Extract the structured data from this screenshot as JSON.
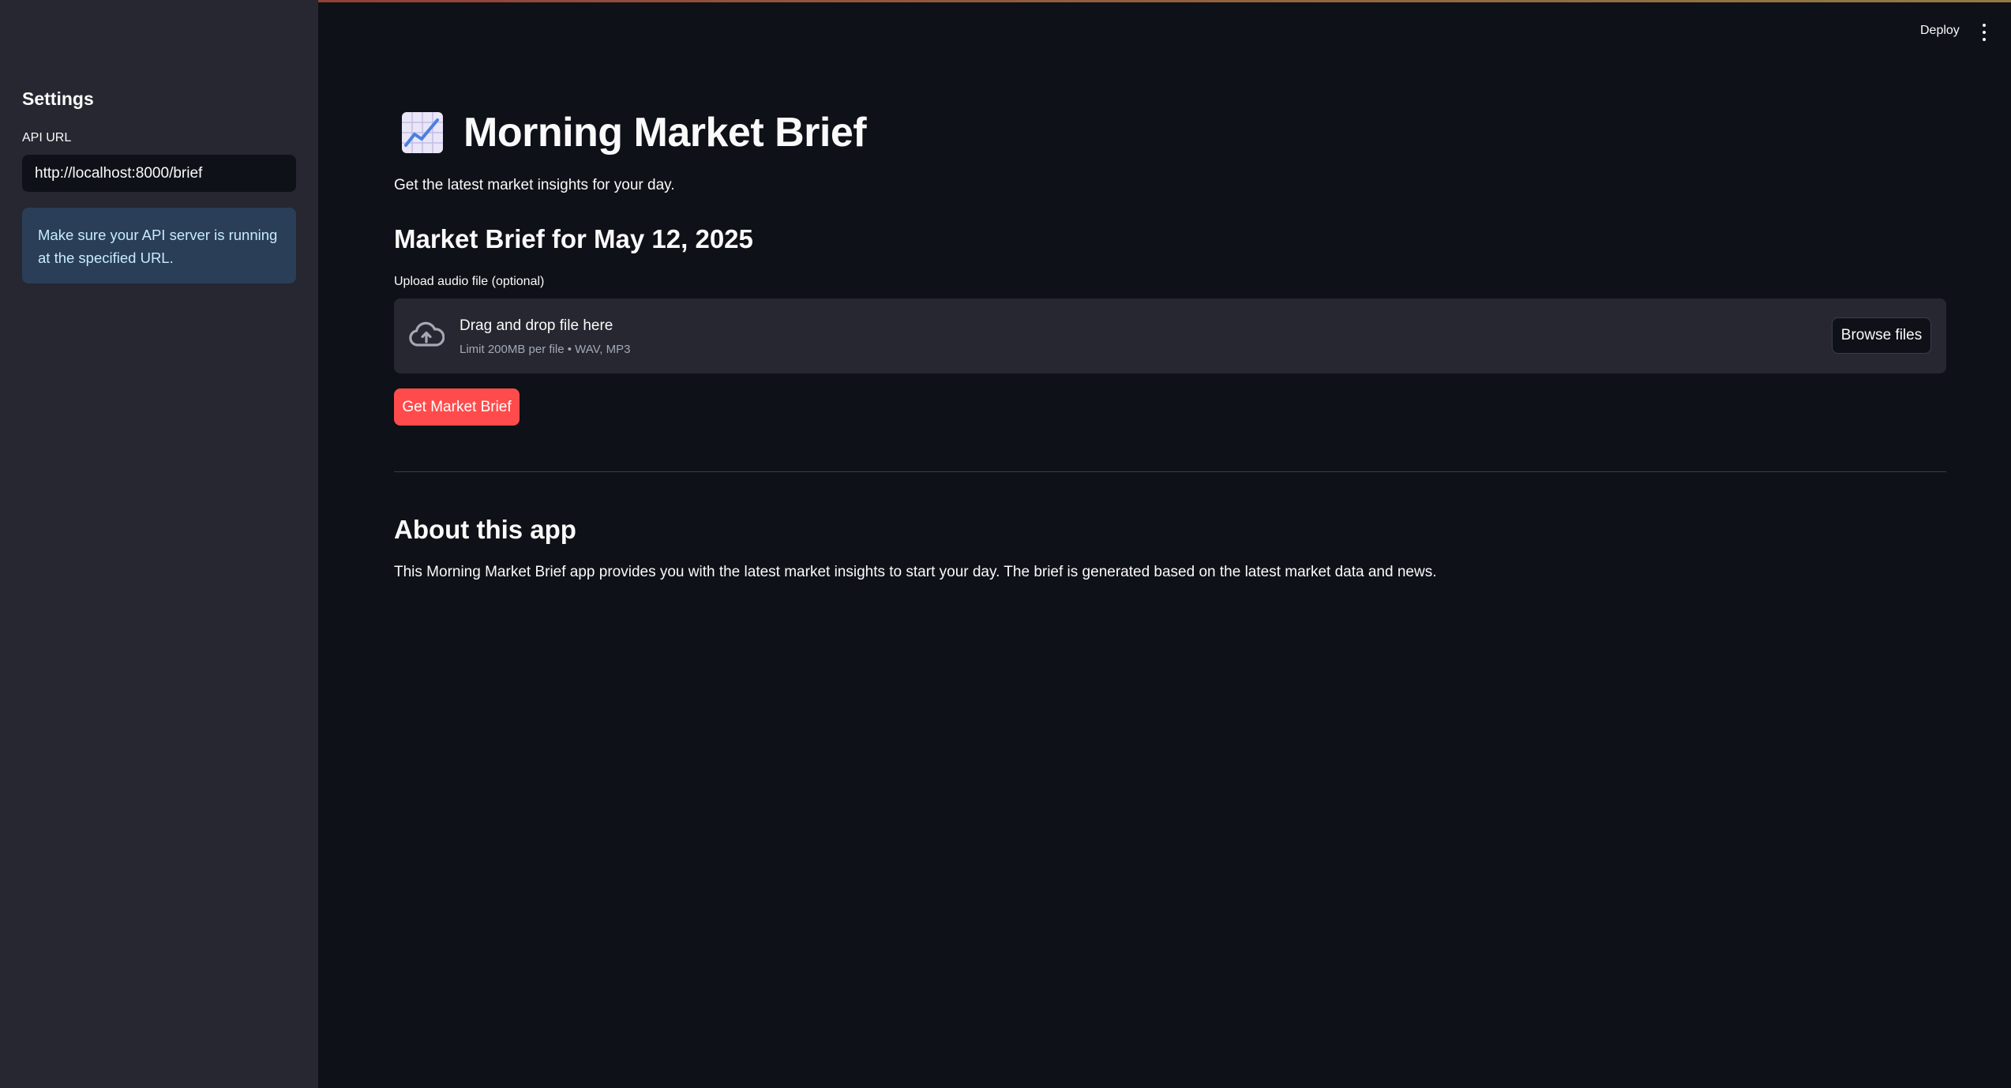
{
  "sidebar": {
    "title": "Settings",
    "api_url_label": "API URL",
    "api_url_value": "http://localhost:8000/brief",
    "info_message": "Make sure your API server is running at the specified URL."
  },
  "header": {
    "deploy_label": "Deploy",
    "menu_icon": "kebab-menu-icon"
  },
  "main": {
    "title_icon": "chart-increasing-icon",
    "title": "Morning Market Brief",
    "subtitle": "Get the latest market insights for your day.",
    "brief_heading": "Market Brief for May 12, 2025",
    "upload": {
      "label": "Upload audio file (optional)",
      "icon": "cloud-upload-icon",
      "drop_text": "Drag and drop file here",
      "limit_text": "Limit 200MB per file • WAV, MP3",
      "browse_label": "Browse files"
    },
    "get_brief_label": "Get Market Brief",
    "about_heading": "About this app",
    "about_text": "This Morning Market Brief app provides you with the latest market insights to start your day. The brief is generated based on the latest market data and news."
  },
  "colors": {
    "background": "#0e1117",
    "sidebar": "#262730",
    "primary": "#ff4b4b",
    "info_bg": "#2a3a52",
    "info_text": "#c7ebff"
  }
}
